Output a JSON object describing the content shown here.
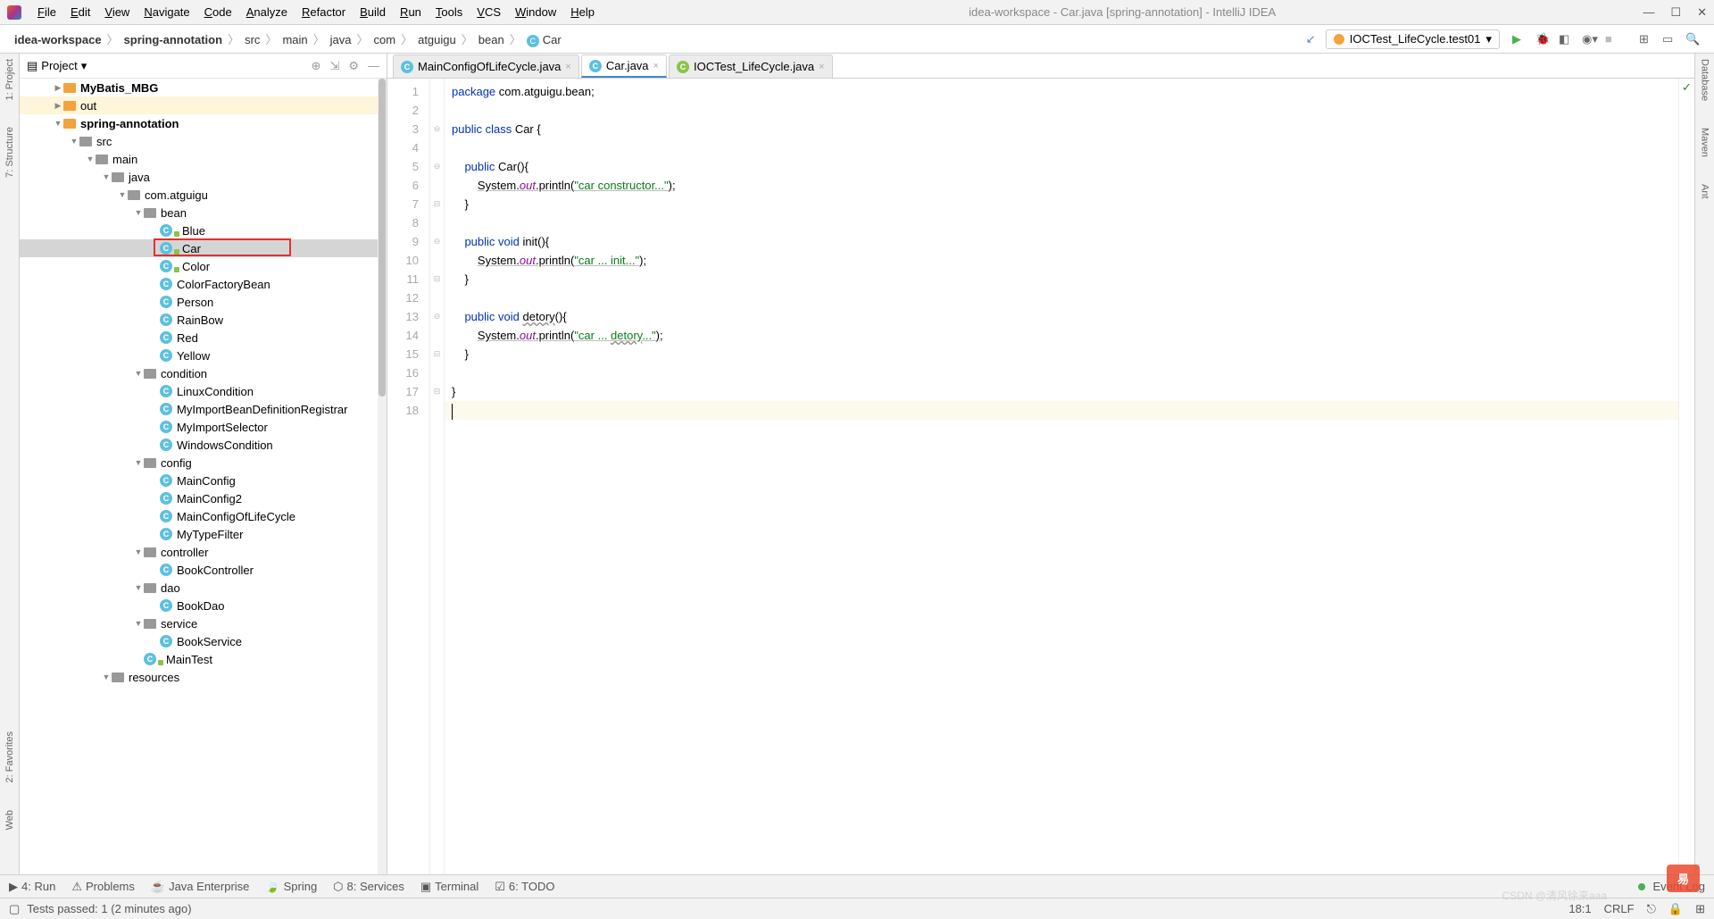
{
  "menu": [
    "File",
    "Edit",
    "View",
    "Navigate",
    "Code",
    "Analyze",
    "Refactor",
    "Build",
    "Run",
    "Tools",
    "VCS",
    "Window",
    "Help"
  ],
  "window_title": "idea-workspace - Car.java [spring-annotation] - IntelliJ IDEA",
  "breadcrumb": [
    "idea-workspace",
    "spring-annotation",
    "src",
    "main",
    "java",
    "com",
    "atguigu",
    "bean",
    "Car"
  ],
  "run_config": "IOCTest_LifeCycle.test01",
  "left_tools": [
    "1: Project",
    "7: Structure",
    "2: Favorites",
    "Web"
  ],
  "right_tools": [
    "Database",
    "Maven",
    "Ant"
  ],
  "sidebar": {
    "title": "Project"
  },
  "tree": [
    {
      "d": 0,
      "i": 1,
      "exp": "r",
      "type": "folder-y",
      "label": "MyBatis_MBG",
      "bold": true
    },
    {
      "d": 0,
      "i": 1,
      "exp": "r",
      "type": "folder-y",
      "label": "out",
      "hl": true
    },
    {
      "d": 0,
      "i": 1,
      "exp": "d",
      "type": "folder-y",
      "label": "spring-annotation",
      "bold": true
    },
    {
      "d": 0,
      "i": 2,
      "exp": "d",
      "type": "folder-g",
      "label": "src"
    },
    {
      "d": 0,
      "i": 3,
      "exp": "d",
      "type": "folder-g",
      "label": "main"
    },
    {
      "d": 0,
      "i": 4,
      "exp": "d",
      "type": "folder-g",
      "label": "java"
    },
    {
      "d": 0,
      "i": 5,
      "exp": "d",
      "type": "folder-g",
      "label": "com.atguigu"
    },
    {
      "d": 0,
      "i": 6,
      "exp": "d",
      "type": "folder-g",
      "label": "bean"
    },
    {
      "d": 0,
      "i": 7,
      "exp": "",
      "type": "class",
      "label": "Blue",
      "badge": true
    },
    {
      "d": 0,
      "i": 7,
      "exp": "",
      "type": "class",
      "label": "Car",
      "badge": true,
      "selected": true,
      "box": true
    },
    {
      "d": 0,
      "i": 7,
      "exp": "",
      "type": "class",
      "label": "Color",
      "badge": true
    },
    {
      "d": 0,
      "i": 7,
      "exp": "",
      "type": "class",
      "label": "ColorFactoryBean"
    },
    {
      "d": 0,
      "i": 7,
      "exp": "",
      "type": "class",
      "label": "Person"
    },
    {
      "d": 0,
      "i": 7,
      "exp": "",
      "type": "class",
      "label": "RainBow"
    },
    {
      "d": 0,
      "i": 7,
      "exp": "",
      "type": "class",
      "label": "Red"
    },
    {
      "d": 0,
      "i": 7,
      "exp": "",
      "type": "class",
      "label": "Yellow"
    },
    {
      "d": 0,
      "i": 6,
      "exp": "d",
      "type": "folder-g",
      "label": "condition"
    },
    {
      "d": 0,
      "i": 7,
      "exp": "",
      "type": "class",
      "label": "LinuxCondition"
    },
    {
      "d": 0,
      "i": 7,
      "exp": "",
      "type": "class",
      "label": "MyImportBeanDefinitionRegistrar"
    },
    {
      "d": 0,
      "i": 7,
      "exp": "",
      "type": "class",
      "label": "MyImportSelector"
    },
    {
      "d": 0,
      "i": 7,
      "exp": "",
      "type": "class",
      "label": "WindowsCondition"
    },
    {
      "d": 0,
      "i": 6,
      "exp": "d",
      "type": "folder-g",
      "label": "config"
    },
    {
      "d": 0,
      "i": 7,
      "exp": "",
      "type": "class",
      "label": "MainConfig"
    },
    {
      "d": 0,
      "i": 7,
      "exp": "",
      "type": "class",
      "label": "MainConfig2"
    },
    {
      "d": 0,
      "i": 7,
      "exp": "",
      "type": "class",
      "label": "MainConfigOfLifeCycle"
    },
    {
      "d": 0,
      "i": 7,
      "exp": "",
      "type": "class",
      "label": "MyTypeFilter"
    },
    {
      "d": 0,
      "i": 6,
      "exp": "d",
      "type": "folder-g",
      "label": "controller"
    },
    {
      "d": 0,
      "i": 7,
      "exp": "",
      "type": "class",
      "label": "BookController"
    },
    {
      "d": 0,
      "i": 6,
      "exp": "d",
      "type": "folder-g",
      "label": "dao"
    },
    {
      "d": 0,
      "i": 7,
      "exp": "",
      "type": "class",
      "label": "BookDao"
    },
    {
      "d": 0,
      "i": 6,
      "exp": "d",
      "type": "folder-g",
      "label": "service"
    },
    {
      "d": 0,
      "i": 7,
      "exp": "",
      "type": "class",
      "label": "BookService"
    },
    {
      "d": 0,
      "i": 6,
      "exp": "",
      "type": "class",
      "label": "MainTest",
      "badge": true
    },
    {
      "d": 0,
      "i": 4,
      "exp": "d",
      "type": "folder-g",
      "label": "resources"
    }
  ],
  "tabs": [
    {
      "name": "MainConfigOfLifeCycle.java",
      "active": false,
      "icon": "c"
    },
    {
      "name": "Car.java",
      "active": true,
      "icon": "c"
    },
    {
      "name": "IOCTest_LifeCycle.java",
      "active": false,
      "icon": "r"
    }
  ],
  "code_lines": 18,
  "bottom": [
    "4: Run",
    "Problems",
    "Java Enterprise",
    "Spring",
    "8: Services",
    "Terminal",
    "6: TODO"
  ],
  "event_log": "Event Log",
  "status_msg": "Tests passed: 1 (2 minutes ago)",
  "status_right": [
    "18:1",
    "CRLF"
  ],
  "watermark": "易",
  "watermark2": "CSDN @清风徐来aaa"
}
